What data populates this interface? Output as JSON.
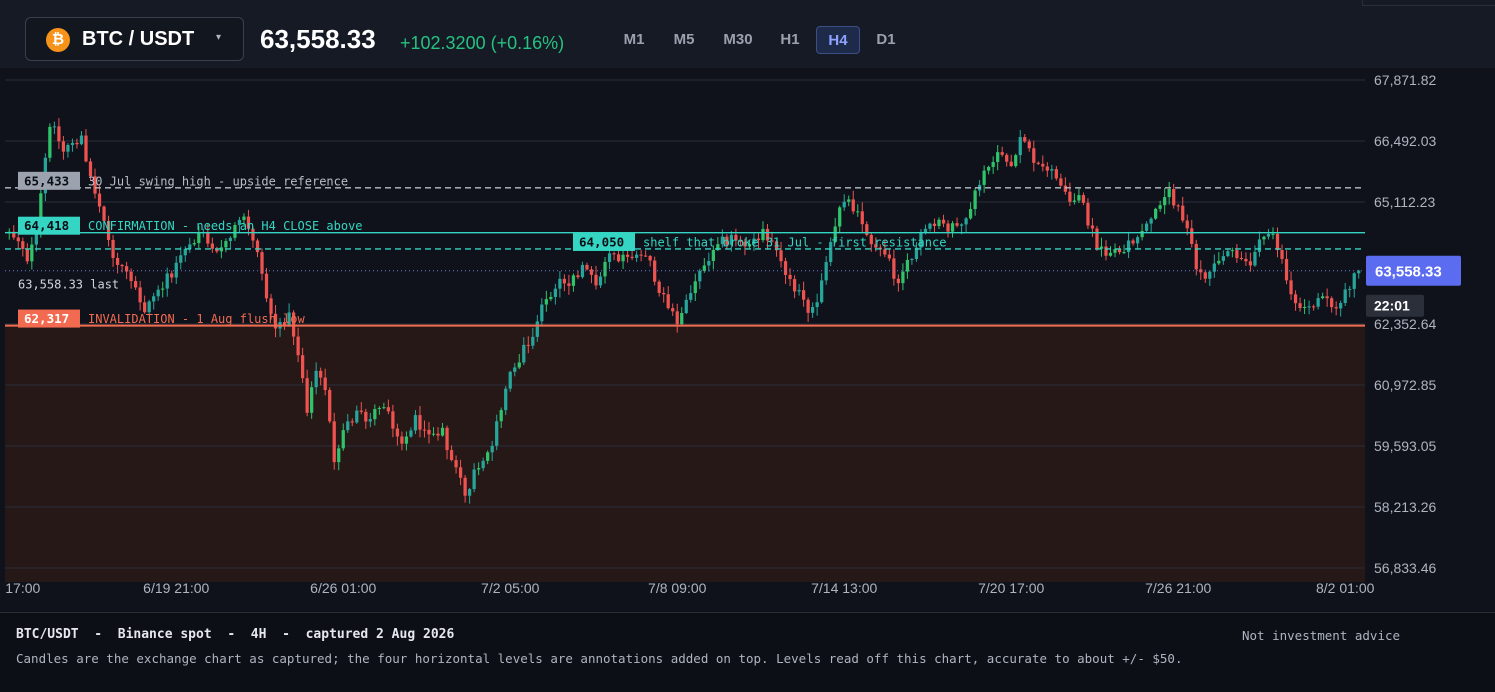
{
  "header": {
    "coin_icon": "₿",
    "pair": "BTC / USDT",
    "caret": "▾",
    "price": "63,558.33",
    "change": "+102.3200 (+0.16%)",
    "timeframes": [
      "M1",
      "M5",
      "M30",
      "H1",
      "H4",
      "D1"
    ],
    "active_timeframe": "H4"
  },
  "chart_data": {
    "type": "candlestick",
    "symbol": "BTC/USDT",
    "interval": "4H",
    "ylim": [
      56300,
      68400
    ],
    "y_ticks": [
      "67,871.82",
      "66,492.03",
      "65,112.23",
      "62,352.64",
      "60,972.85",
      "59,593.05",
      "58,213.26",
      "56,833.46"
    ],
    "y_tick_values": [
      67871.82,
      66492.03,
      65112.23,
      62352.64,
      60972.85,
      59593.05,
      58213.26,
      56833.46
    ],
    "x_ticks": [
      "17:00",
      "6/19 21:00",
      "6/26 01:00",
      "7/2 05:00",
      "7/8 09:00",
      "7/14 13:00",
      "7/20 17:00",
      "7/26 21:00",
      "8/2 01:00"
    ],
    "bar_count": 300,
    "x_tick_bars": [
      3,
      37,
      74,
      111,
      148,
      185,
      222,
      259,
      296
    ],
    "last_price": 63558.33,
    "last_label": "63,558.33",
    "countdown": "22:01",
    "last_text": "63,558.33  last",
    "keypoints": [
      [
        0,
        64400
      ],
      [
        4,
        63850
      ],
      [
        6,
        64600
      ],
      [
        9,
        66900
      ],
      [
        12,
        66300
      ],
      [
        16,
        66500
      ],
      [
        20,
        65000
      ],
      [
        23,
        63900
      ],
      [
        26,
        63500
      ],
      [
        30,
        62600
      ],
      [
        34,
        63200
      ],
      [
        37,
        63700
      ],
      [
        40,
        64200
      ],
      [
        43,
        64350
      ],
      [
        46,
        64100
      ],
      [
        49,
        64350
      ],
      [
        52,
        64700
      ],
      [
        55,
        64100
      ],
      [
        57,
        62900
      ],
      [
        59,
        62300
      ],
      [
        62,
        62500
      ],
      [
        64,
        61700
      ],
      [
        66,
        60300
      ],
      [
        68,
        61400
      ],
      [
        70,
        60800
      ],
      [
        72,
        59300
      ],
      [
        74,
        59900
      ],
      [
        77,
        60400
      ],
      [
        80,
        60200
      ],
      [
        82,
        60500
      ],
      [
        84,
        60300
      ],
      [
        87,
        59600
      ],
      [
        90,
        60200
      ],
      [
        93,
        59800
      ],
      [
        96,
        59900
      ],
      [
        99,
        59000
      ],
      [
        101,
        58500
      ],
      [
        104,
        59200
      ],
      [
        107,
        59700
      ],
      [
        109,
        60500
      ],
      [
        111,
        61200
      ],
      [
        113,
        61600
      ],
      [
        116,
        62100
      ],
      [
        118,
        62800
      ],
      [
        120,
        63000
      ],
      [
        122,
        63400
      ],
      [
        124,
        63200
      ],
      [
        127,
        63600
      ],
      [
        130,
        63300
      ],
      [
        133,
        63900
      ],
      [
        136,
        63800
      ],
      [
        139,
        64050
      ],
      [
        142,
        63700
      ],
      [
        145,
        62900
      ],
      [
        148,
        62400
      ],
      [
        150,
        62900
      ],
      [
        152,
        63300
      ],
      [
        155,
        63800
      ],
      [
        158,
        64200
      ],
      [
        161,
        64300
      ],
      [
        164,
        64100
      ],
      [
        167,
        64400
      ],
      [
        169,
        64100
      ],
      [
        172,
        63500
      ],
      [
        175,
        63000
      ],
      [
        177,
        62600
      ],
      [
        179,
        62800
      ],
      [
        182,
        64200
      ],
      [
        184,
        64900
      ],
      [
        186,
        65200
      ],
      [
        188,
        64800
      ],
      [
        190,
        64400
      ],
      [
        193,
        64000
      ],
      [
        195,
        63800
      ],
      [
        197,
        63200
      ],
      [
        199,
        63700
      ],
      [
        201,
        64200
      ],
      [
        203,
        64500
      ],
      [
        206,
        64700
      ],
      [
        208,
        64500
      ],
      [
        211,
        64600
      ],
      [
        213,
        65000
      ],
      [
        215,
        65600
      ],
      [
        217,
        66000
      ],
      [
        220,
        66300
      ],
      [
        222,
        66000
      ],
      [
        224,
        66600
      ],
      [
        227,
        66100
      ],
      [
        230,
        65900
      ],
      [
        233,
        65500
      ],
      [
        235,
        65100
      ],
      [
        237,
        65300
      ],
      [
        239,
        64700
      ],
      [
        241,
        64100
      ],
      [
        244,
        63900
      ],
      [
        247,
        64100
      ],
      [
        249,
        64300
      ],
      [
        252,
        64600
      ],
      [
        255,
        65000
      ],
      [
        257,
        65300
      ],
      [
        259,
        65000
      ],
      [
        261,
        64500
      ],
      [
        263,
        63600
      ],
      [
        265,
        63400
      ],
      [
        268,
        63700
      ],
      [
        270,
        64000
      ],
      [
        272,
        63800
      ],
      [
        275,
        63700
      ],
      [
        277,
        64300
      ],
      [
        280,
        64300
      ],
      [
        282,
        63800
      ],
      [
        284,
        63100
      ],
      [
        286,
        62700
      ],
      [
        289,
        62800
      ],
      [
        292,
        62900
      ],
      [
        294,
        62600
      ],
      [
        296,
        63100
      ],
      [
        299,
        63558
      ]
    ],
    "levels": [
      {
        "price": 65433,
        "label": "65,433",
        "text": "30 Jul swing high - upside reference",
        "style": "dashed",
        "color": "#b9bdc7"
      },
      {
        "price": 64418,
        "label": "64,418",
        "text": "CONFIRMATION - needs an H4 CLOSE above",
        "style": "solid",
        "color": "#34d6c3"
      },
      {
        "price": 64050,
        "label": "64,050",
        "text": "shelf that broke 31 Jul - first resistance",
        "style": "dashed",
        "color": "#34d6c3"
      },
      {
        "price": 62317,
        "label": "62,317",
        "text": "INVALIDATION - 1 Aug flush low",
        "style": "solid",
        "color": "#f26b50"
      }
    ],
    "up_color": "#26a69a",
    "up_color_bright": "#2fc46b",
    "down_color": "#ef5350"
  },
  "footer": {
    "title": "BTC/USDT  -  Binance spot  -  4H  -  captured 2 Aug 2026",
    "disclaimer": "Not investment advice",
    "note": "Candles are the exchange chart as captured; the four horizontal levels are annotations added on top. Levels read off this chart, accurate to about +/- $50."
  }
}
